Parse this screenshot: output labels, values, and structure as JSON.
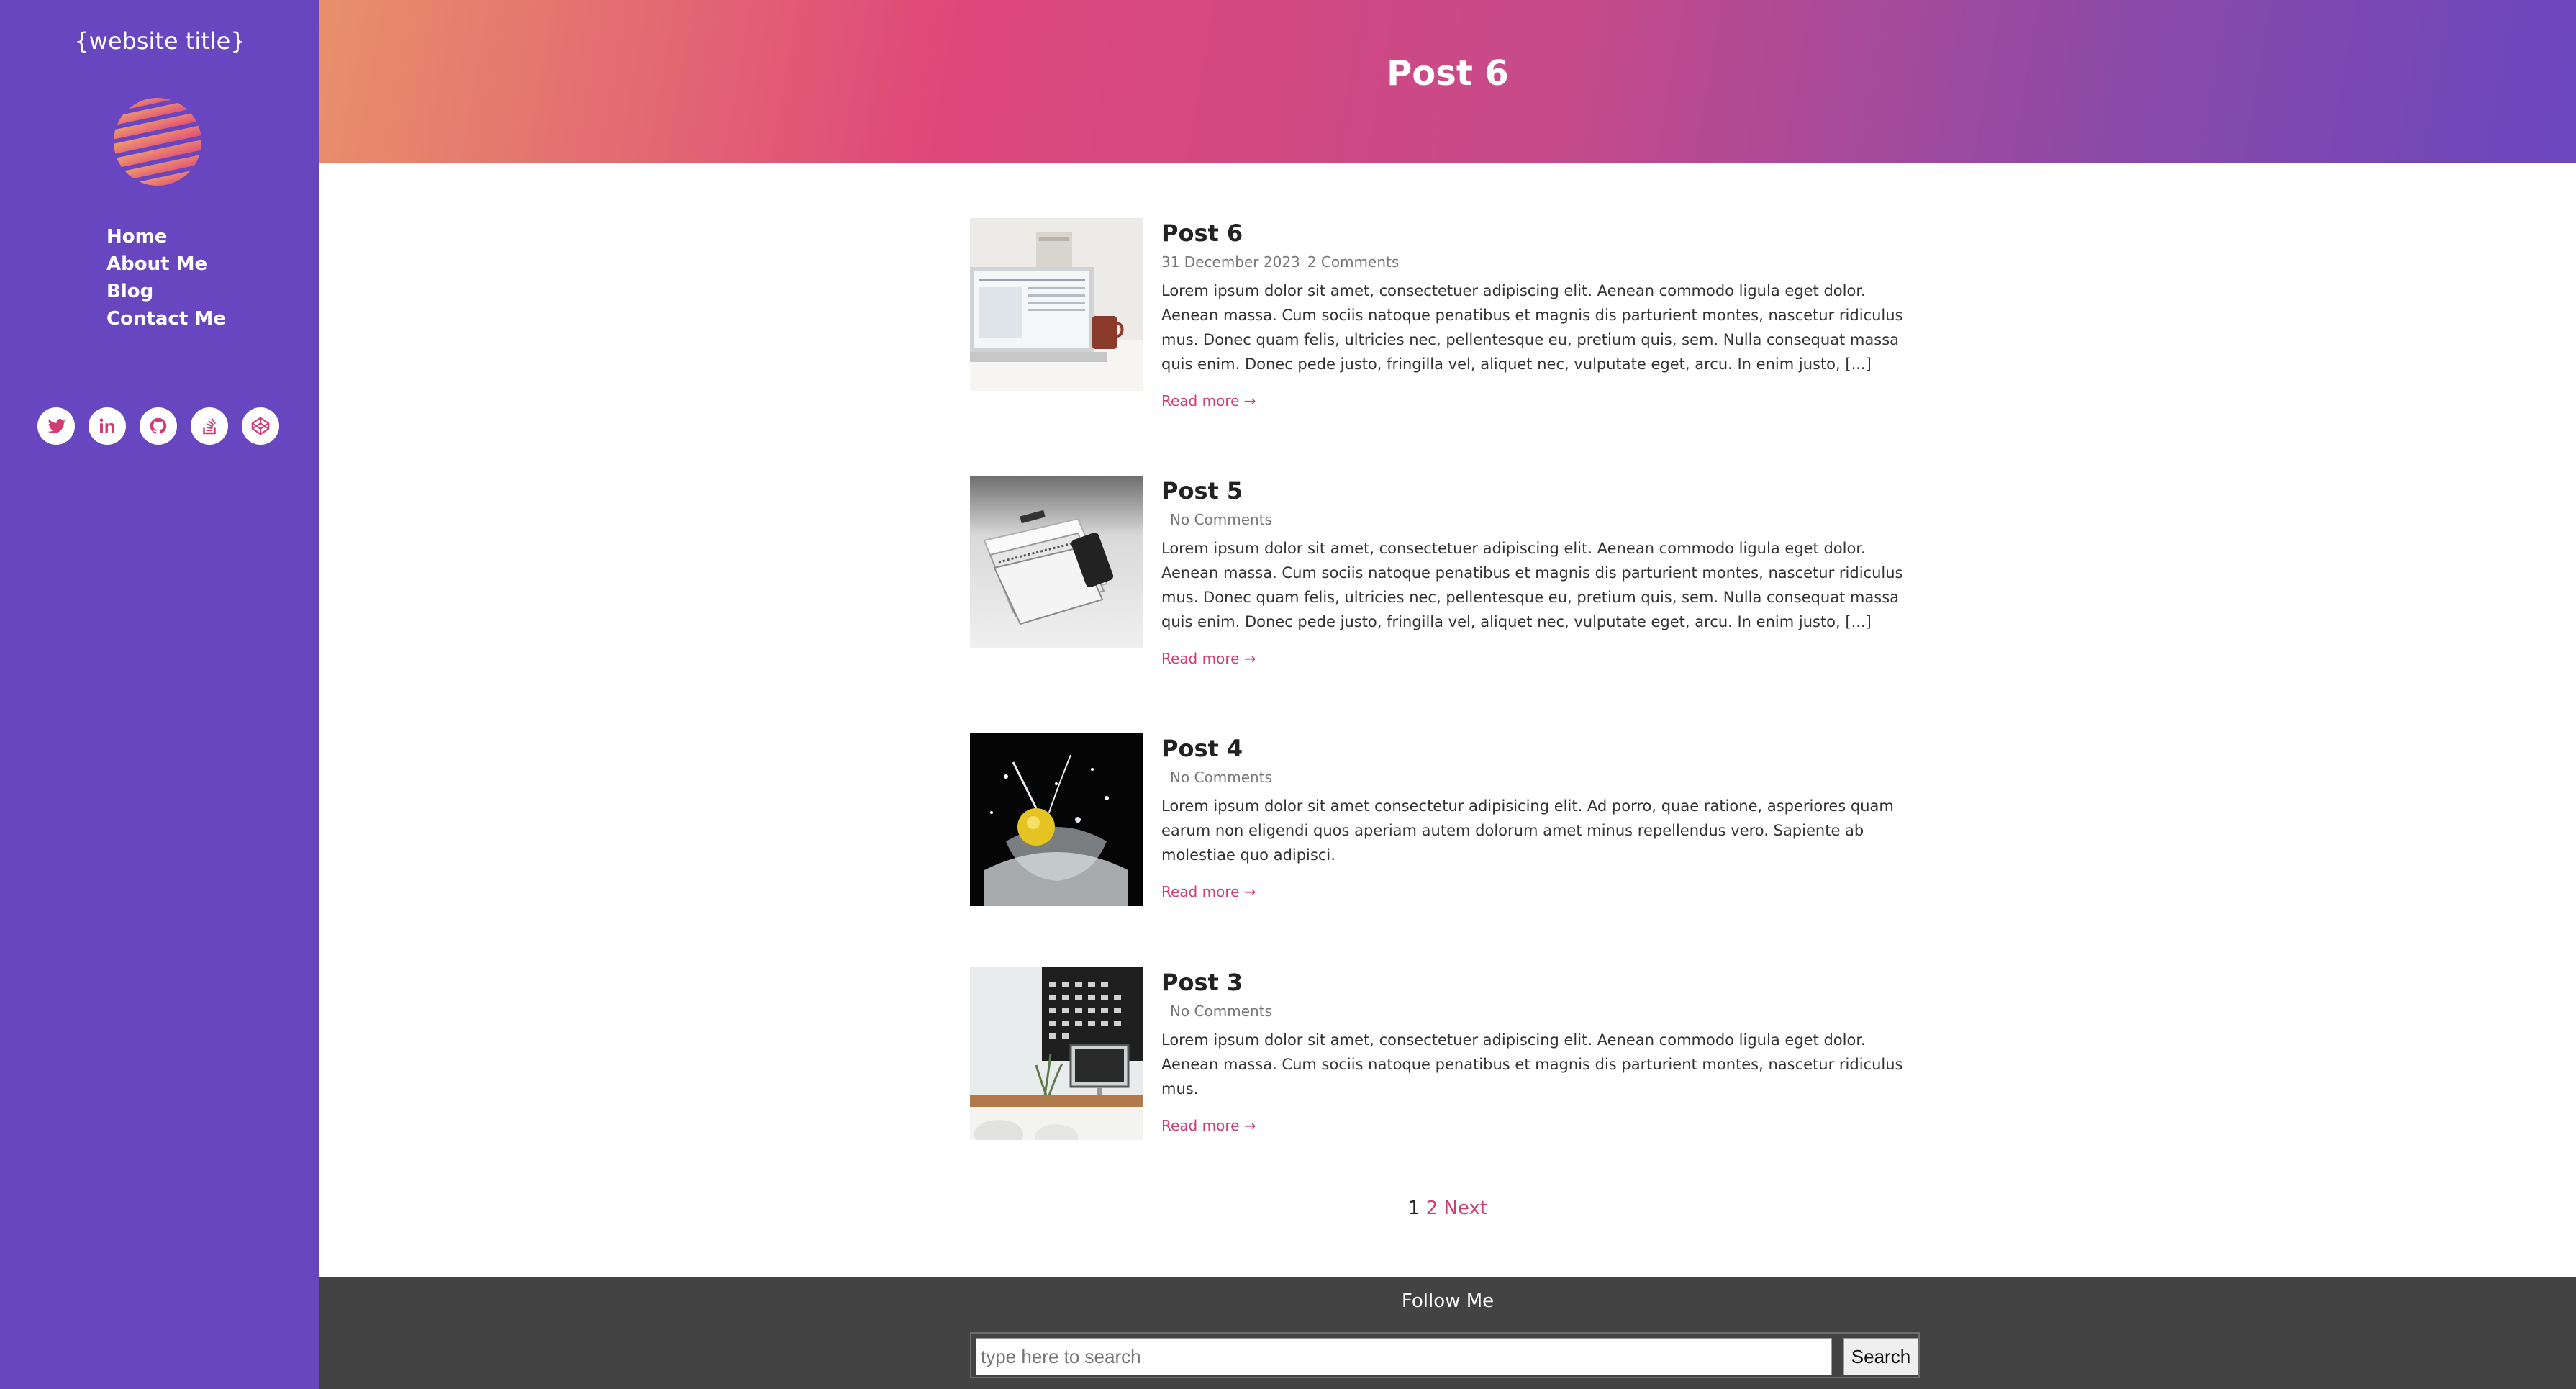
{
  "sidebar": {
    "site_title": "{website title}",
    "nav": [
      "Home",
      "About Me",
      "Blog",
      "Contact Me"
    ],
    "social_icons": [
      "twitter-icon",
      "linkedin-icon",
      "github-icon",
      "stackoverflow-icon",
      "codepen-icon"
    ]
  },
  "header": {
    "title": "Post 6"
  },
  "posts": [
    {
      "title": "Post 6",
      "date": "31 December 2023",
      "comments": "2 Comments",
      "excerpt": "Lorem ipsum dolor sit amet, consectetuer adipiscing elit. Aenean commodo ligula eget dolor. Aenean massa. Cum sociis natoque penatibus et magnis dis parturient montes, nascetur ridiculus mus. Donec quam felis, ultricies nec, pellentesque eu, pretium quis, sem. Nulla consequat massa quis enim. Donec pede justo, fringilla vel, aliquet nec, vulputate eget, arcu. In enim justo, [...]",
      "read_more": "Read more →",
      "image": "laptop-desk-photo"
    },
    {
      "title": "Post 5",
      "date": "",
      "comments": "No Comments",
      "excerpt": "Lorem ipsum dolor sit amet, consectetuer adipiscing elit. Aenean commodo ligula eget dolor. Aenean massa. Cum sociis natoque penatibus et magnis dis parturient montes, nascetur ridiculus mus. Donec quam felis, ultricies nec, pellentesque eu, pretium quis, sem. Nulla consequat massa quis enim. Donec pede justo, fringilla vel, aliquet nec, vulputate eget, arcu. In enim justo, [...]",
      "read_more": "Read more →",
      "image": "notebooks-phone-photo"
    },
    {
      "title": "Post 4",
      "date": "",
      "comments": "No Comments",
      "excerpt": "Lorem ipsum dolor sit amet consectetur adipisicing elit. Ad porro, quae ratione, asperiores quam earum non eligendi quos aperiam autem dolorum amet minus repellendus vero. Sapiente ab molestiae quo adipisci.",
      "read_more": "Read more →",
      "image": "lemon-splash-photo"
    },
    {
      "title": "Post 3",
      "date": "",
      "comments": "No Comments",
      "excerpt": "Lorem ipsum dolor sit amet, consectetuer adipiscing elit. Aenean commodo ligula eget dolor. Aenean massa. Cum sociis natoque penatibus et magnis dis parturient montes, nascetur ridiculus mus.",
      "read_more": "Read more →",
      "image": "calendar-desk-photo"
    }
  ],
  "pagination": {
    "current": "1",
    "next_page": "2",
    "next_label": "Next"
  },
  "footer": {
    "follow": "Follow Me",
    "search_placeholder": "type here to search",
    "search_button": "Search"
  },
  "colors": {
    "sidebar": "#6846bf",
    "accent": "#d33b72",
    "footer": "#434343",
    "banner_gradient": [
      "#e8906a",
      "#df477a",
      "#6a46bf"
    ]
  }
}
